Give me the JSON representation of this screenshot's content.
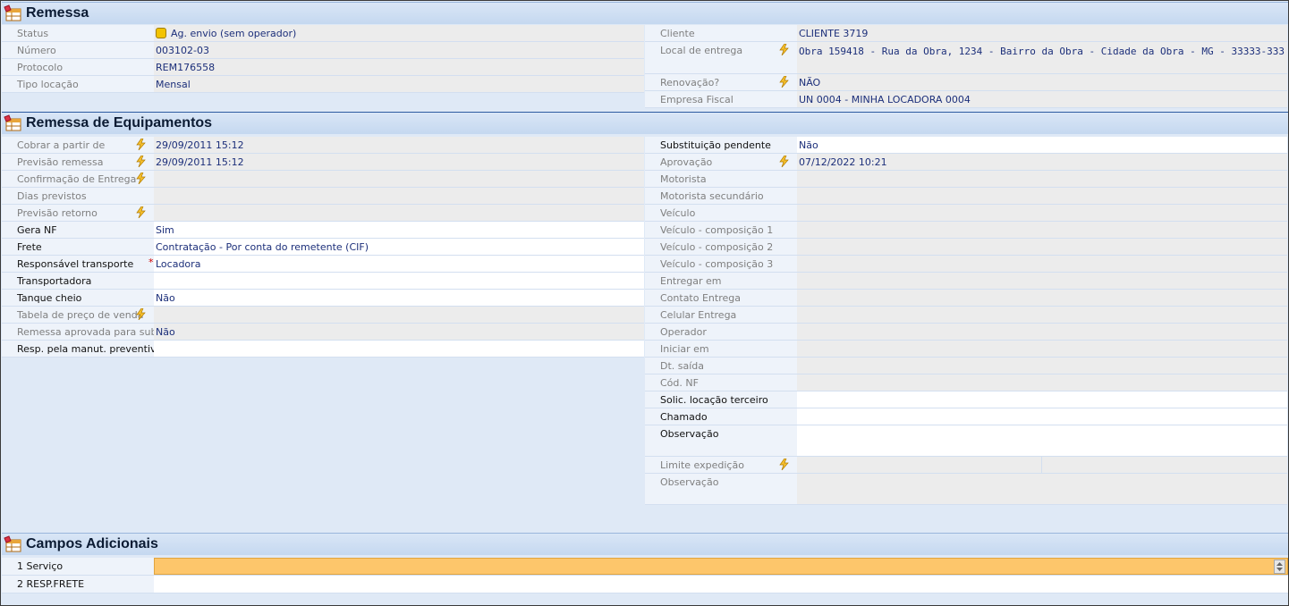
{
  "sections": {
    "remessa": {
      "title": "Remessa",
      "left": [
        {
          "label": "Status",
          "value": "Ag. envio (sem operador)"
        },
        {
          "label": "Número",
          "value": "003102-03"
        },
        {
          "label": "Protocolo",
          "value": "REM176558"
        },
        {
          "label": "Tipo locação",
          "value": "Mensal"
        }
      ],
      "right": [
        {
          "label": "Cliente",
          "value": "CLIENTE  3719"
        },
        {
          "label": "Local de entrega",
          "value": "Obra 159418 - Rua da Obra, 1234 - Bairro da Obra - Cidade da Obra - MG - 33333-333"
        },
        {
          "label": "Renovação?",
          "value": "NÃO"
        },
        {
          "label": "Empresa Fiscal",
          "value": "UN 0004 - MINHA LOCADORA 0004"
        }
      ]
    },
    "equip": {
      "title": "Remessa de Equipamentos",
      "left": [
        {
          "label": "Cobrar a partir de",
          "value": "29/09/2011 15:12"
        },
        {
          "label": "Previsão remessa",
          "value": "29/09/2011 15:12"
        },
        {
          "label": "Confirmação de Entrega",
          "value": ""
        },
        {
          "label": "Dias previstos",
          "value": ""
        },
        {
          "label": "Previsão retorno",
          "value": ""
        },
        {
          "label": "Gera NF",
          "value": "Sim"
        },
        {
          "label": "Frete",
          "value": "Contratação - Por conta do remetente (CIF)"
        },
        {
          "label": "Responsável transporte",
          "value": "Locadora"
        },
        {
          "label": "Transportadora",
          "value": ""
        },
        {
          "label": "Tanque cheio",
          "value": "Não"
        },
        {
          "label": "Tabela de preço de venda",
          "value": ""
        },
        {
          "label": "Remessa aprovada para substituição",
          "value": "Não"
        },
        {
          "label": "Resp. pela manut. preventiva",
          "value": ""
        }
      ],
      "right": [
        {
          "label": "Substituição pendente",
          "value": "Não"
        },
        {
          "label": "Aprovação",
          "value": "07/12/2022 10:21"
        },
        {
          "label": "Motorista",
          "value": ""
        },
        {
          "label": "Motorista secundário",
          "value": ""
        },
        {
          "label": "Veículo",
          "value": ""
        },
        {
          "label": "Veículo - composição 1",
          "value": ""
        },
        {
          "label": "Veículo - composição 2",
          "value": ""
        },
        {
          "label": "Veículo - composição 3",
          "value": ""
        },
        {
          "label": "Entregar em",
          "value": ""
        },
        {
          "label": "Contato Entrega",
          "value": ""
        },
        {
          "label": "Celular Entrega",
          "value": ""
        },
        {
          "label": "Operador",
          "value": ""
        },
        {
          "label": "Iniciar em",
          "value": ""
        },
        {
          "label": "Dt. saída",
          "value": ""
        },
        {
          "label": "Cód. NF",
          "value": ""
        },
        {
          "label": "Solic. locação terceiro",
          "value": ""
        },
        {
          "label": "Chamado",
          "value": ""
        },
        {
          "label": "Observação",
          "value": ""
        },
        {
          "label": "Limite expedição",
          "value": ""
        },
        {
          "label": "Observação",
          "value": ""
        }
      ]
    },
    "campos": {
      "title": "Campos Adicionais",
      "rows": [
        {
          "label": "1 Serviço",
          "value": ""
        },
        {
          "label": "2 RESP.FRETE",
          "value": ""
        }
      ]
    }
  },
  "colors": {
    "header": "#c5d8f0",
    "selected": "#fdc66b",
    "value_text": "#1c2f7a"
  },
  "icons": [
    "table-icon",
    "lightning-icon",
    "status-led-icon",
    "scroll-arrows-icon"
  ]
}
